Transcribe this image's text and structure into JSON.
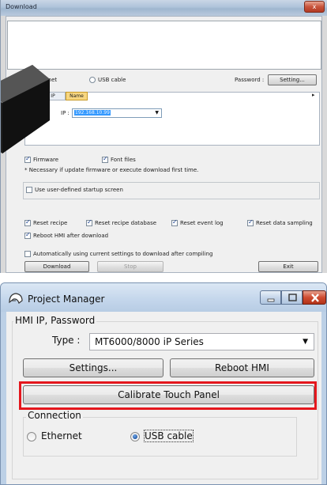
{
  "download_window": {
    "title": "Download",
    "close_label": "x",
    "connection": {
      "ethernet_label": "Ethernet",
      "usb_label": "USB cable",
      "selected": "Ethernet"
    },
    "password_label": "Password :",
    "setting_button": "Setting...",
    "tabs": {
      "ip_label": "IP",
      "name_label": "Name"
    },
    "ip_field_label": "IP :",
    "ip_value": "192.168.10.99",
    "tab_scroll_icon": "arrow-right-icon",
    "checkboxes": {
      "firmware": "Firmware",
      "font_files": "Font files",
      "note": "* Necessary if update firmware or execute download first time.",
      "startup_screen": "Use user-defined startup screen",
      "reset_recipe": "Reset recipe",
      "reset_recipe_db": "Reset recipe database",
      "reset_event_log": "Reset event log",
      "reset_data_sampling": "Reset data sampling",
      "reboot_hmi": "Reboot HMI after download",
      "auto_settings": "Automatically using current settings to download after compiling"
    },
    "buttons": {
      "download": "Download",
      "stop": "Stop",
      "exit": "Exit"
    }
  },
  "project_manager": {
    "title": "Project Manager",
    "window_buttons": {
      "minimize_icon": "minimize-icon",
      "maximize_icon": "maximize-icon",
      "close_icon": "close-icon"
    },
    "hmi_group_label": "HMI IP, Password",
    "type_label": "Type :",
    "type_value": "MT6000/8000 iP Series",
    "settings_button": "Settings...",
    "reboot_button": "Reboot HMI",
    "calibrate_button": "Calibrate Touch Panel",
    "connection_group_label": "Connection",
    "ethernet_label": "Ethernet",
    "usb_label": "USB cable",
    "selected_connection": "USB cable",
    "highlight_color": "#e4171d"
  }
}
